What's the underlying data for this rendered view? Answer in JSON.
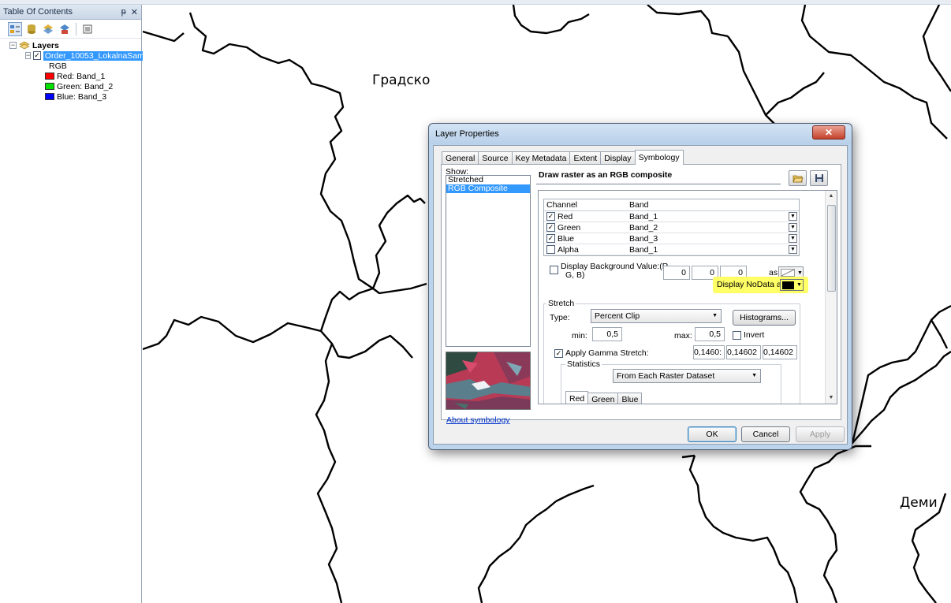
{
  "toc": {
    "title": "Table Of Contents",
    "pin": "Ɑ",
    "close": "✕",
    "layers_root": "Layers",
    "layer_name": "Order_10053_LokalnaSam",
    "rgb_label": "RGB",
    "bands": [
      {
        "label": "Red:  Band_1",
        "color": "#ff0000"
      },
      {
        "label": "Green: Band_2",
        "color": "#00e000"
      },
      {
        "label": "Blue:  Band_3",
        "color": "#0000ff"
      }
    ]
  },
  "map": {
    "labels": [
      "Градско",
      "Деми"
    ]
  },
  "dialog": {
    "title": "Layer Properties",
    "close_glyph": "✕",
    "tabs": [
      "General",
      "Source",
      "Key Metadata",
      "Extent",
      "Display",
      "Symbology"
    ],
    "active_tab": "Symbology",
    "show_label": "Show:",
    "show_items": [
      "Stretched",
      "RGB Composite"
    ],
    "selected_show_item": "RGB Composite",
    "about_link": "About symbology",
    "draw_title": "Draw raster as an RGB composite",
    "channel_header": "Channel",
    "band_header": "Band",
    "channels": [
      {
        "name": "Red",
        "band": "Band_1",
        "checked": true
      },
      {
        "name": "Green",
        "band": "Band_2",
        "checked": true
      },
      {
        "name": "Blue",
        "band": "Band_3",
        "checked": true
      },
      {
        "name": "Alpha",
        "band": "Band_1",
        "checked": false
      }
    ],
    "bg_label_1": "Display Background Value:(R,",
    "bg_label_2": "G, B)",
    "bg_values": [
      "0",
      "0",
      "0"
    ],
    "as_label": "as",
    "nodata_label": "Display NoData as",
    "stretch_label": "Stretch",
    "type_label": "Type:",
    "type_value": "Percent Clip",
    "histograms_button": "Histograms...",
    "min_label": "min:",
    "min_value": "0,5",
    "max_label": "max:",
    "max_value": "0,5",
    "invert_label": "Invert",
    "gamma_label": "Apply Gamma Stretch:",
    "gamma_values": [
      "0,1460:",
      "0,14602",
      "0,14602"
    ],
    "statistics_label": "Statistics",
    "statistics_value": "From Each Raster Dataset",
    "stat_tabs": [
      "Red",
      "Green",
      "Blue"
    ],
    "ok": "OK",
    "cancel": "Cancel",
    "apply": "Apply"
  }
}
